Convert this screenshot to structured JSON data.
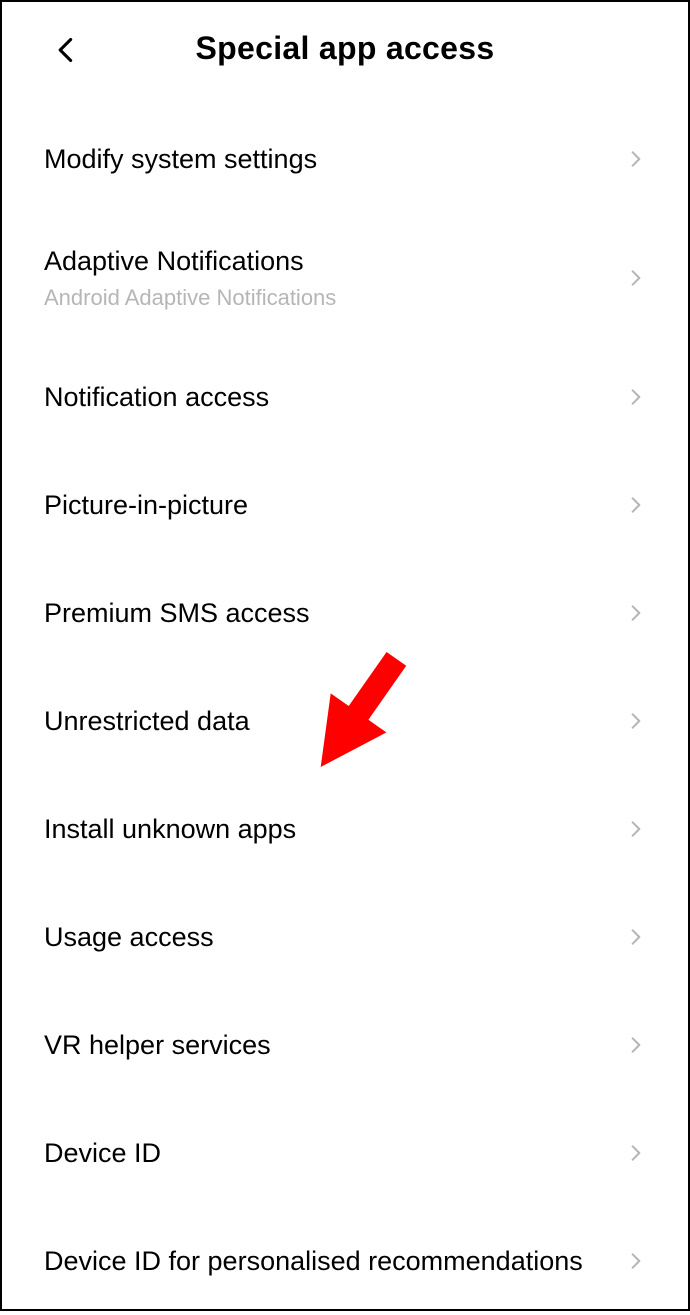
{
  "header": {
    "title": "Special app access"
  },
  "items": [
    {
      "title": "Modify system settings",
      "sub": ""
    },
    {
      "title": "Adaptive Notifications",
      "sub": "Android Adaptive Notifications"
    },
    {
      "title": "Notification access",
      "sub": ""
    },
    {
      "title": "Picture-in-picture",
      "sub": ""
    },
    {
      "title": "Premium SMS access",
      "sub": ""
    },
    {
      "title": "Unrestricted data",
      "sub": ""
    },
    {
      "title": "Install unknown apps",
      "sub": ""
    },
    {
      "title": "Usage access",
      "sub": ""
    },
    {
      "title": "VR helper services",
      "sub": ""
    },
    {
      "title": "Device ID",
      "sub": ""
    },
    {
      "title": "Device ID for personalised recommendations",
      "sub": ""
    }
  ],
  "annotation": {
    "points_to_item_index": 6,
    "color": "#ff0000"
  }
}
